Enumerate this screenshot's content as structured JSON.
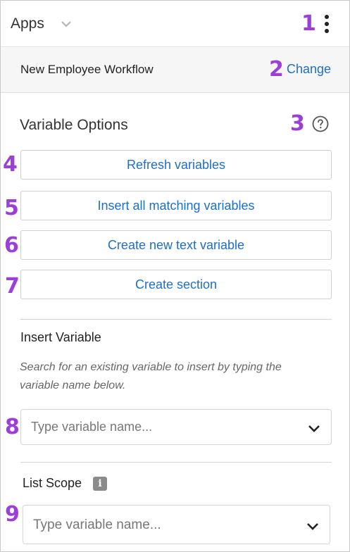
{
  "header": {
    "apps_label": "Apps",
    "menu_icon": "kebab-menu-icon",
    "dropdown_icon": "chevron-down-icon"
  },
  "workflow": {
    "name": "New Employee Workflow",
    "change_label": "Change"
  },
  "variable_options": {
    "title": "Variable Options",
    "help_icon": "question-circle-icon",
    "buttons": [
      {
        "label": "Refresh variables"
      },
      {
        "label": "Insert all matching variables"
      },
      {
        "label": "Create new text variable"
      },
      {
        "label": "Create section"
      }
    ]
  },
  "insert_variable": {
    "title": "Insert Variable",
    "hint": "Search for an existing variable to insert by typing the variable name below.",
    "placeholder": "Type variable name..."
  },
  "list_scope": {
    "title": "List Scope",
    "info_icon": "info-icon",
    "placeholder": "Type variable name..."
  },
  "markers": [
    "1",
    "2",
    "3",
    "4",
    "5",
    "6",
    "7",
    "8",
    "9"
  ],
  "colors": {
    "accent_link": "#1f6fc5",
    "marker": "#9b3fd8",
    "border": "#cfcfcf"
  }
}
